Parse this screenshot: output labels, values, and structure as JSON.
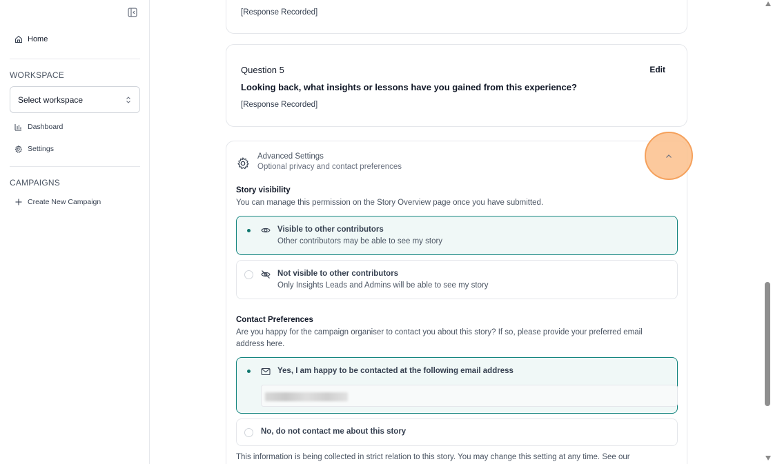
{
  "sidebar": {
    "home_label": "Home",
    "workspace_heading": "WORKSPACE",
    "workspace_select": "Select workspace",
    "dashboard_label": "Dashboard",
    "settings_label": "Settings",
    "campaigns_heading": "CAMPAIGNS",
    "create_campaign_label": "Create New Campaign"
  },
  "questions": {
    "prev_response": "[Response Recorded]",
    "q5": {
      "number": "Question 5",
      "edit_label": "Edit",
      "text": "Looking back, what insights or lessons have you gained from this experience?",
      "response": "[Response Recorded]"
    }
  },
  "advanced": {
    "title": "Advanced Settings",
    "subtitle": "Optional privacy and contact preferences",
    "visibility": {
      "label": "Story visibility",
      "description": "You can manage this permission on the Story Overview page once you have submitted.",
      "options": [
        {
          "title": "Visible to other contributors",
          "subtitle": "Other contributors may be able to see my story",
          "selected": true,
          "icon": "eye-icon"
        },
        {
          "title": "Not visible to other contributors",
          "subtitle": "Only Insights Leads and Admins will be able to see my story",
          "selected": false,
          "icon": "eye-off-icon"
        }
      ]
    },
    "contact": {
      "label": "Contact Preferences",
      "description_line1": "Are you happy for the campaign organiser to contact you about this story? If so, please provide your preferred email",
      "description_line2": "address here.",
      "options": [
        {
          "title": "Yes, I am happy to be contacted at the following email address",
          "selected": true,
          "icon": "mail-icon"
        },
        {
          "title": "No, do not contact me about this story",
          "selected": false
        }
      ]
    },
    "footer": "This information is being collected in strict relation to this story. You may change this setting at any time. See our"
  },
  "colors": {
    "accent": "#0f766e",
    "selected_bg": "#f0f8f7",
    "highlight": "#fbbf8c"
  }
}
